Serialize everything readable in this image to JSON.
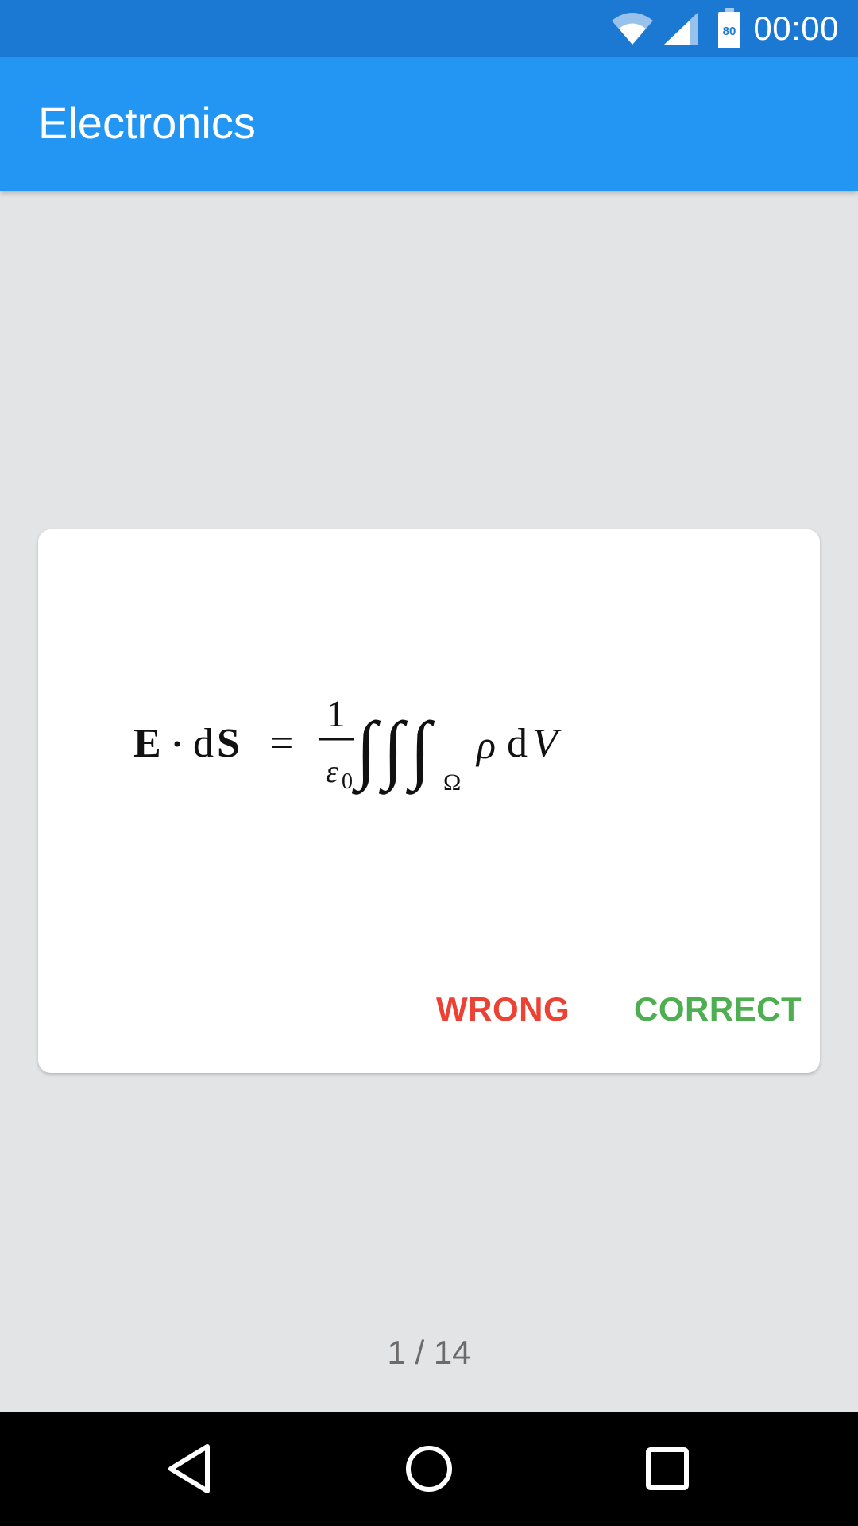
{
  "status_bar": {
    "time": "00:00",
    "battery_level": "80",
    "icons": [
      "wifi-icon",
      "cell-signal-icon",
      "battery-icon"
    ]
  },
  "app_bar": {
    "title": "Electronics"
  },
  "card": {
    "formula_latex": "\\mathbf{E}\\cdot d\\mathbf{S} = \\frac{1}{\\varepsilon_0}\\iiint_\\Omega \\rho\\, dV",
    "actions": {
      "wrong_label": "WRONG",
      "correct_label": "CORRECT"
    }
  },
  "pager": {
    "text": "1 / 14"
  },
  "nav_bar": {
    "icons": [
      "back-icon",
      "home-icon",
      "recents-icon"
    ]
  },
  "colors": {
    "status_bar": "#1c79d3",
    "app_bar": "#2296f2",
    "background": "#e3e4e6",
    "wrong": "#ed4134",
    "correct": "#4daf4f"
  }
}
